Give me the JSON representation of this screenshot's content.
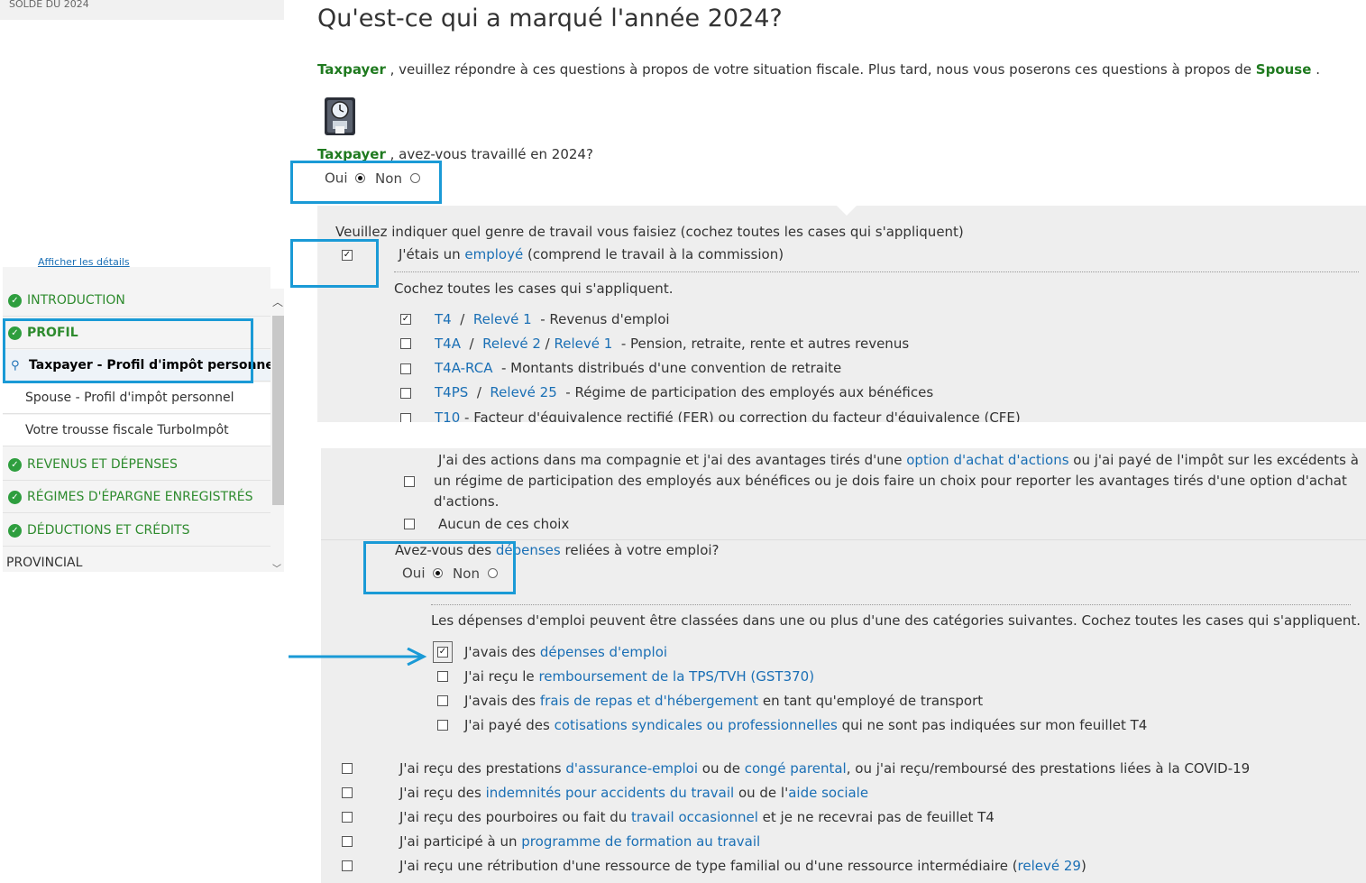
{
  "sidebar": {
    "balance_label": "SOLDE DU 2024",
    "details_link": "Afficher les détails",
    "nav": [
      {
        "label": "INTRODUCTION"
      },
      {
        "label": "PROFIL"
      },
      {
        "label": "Taxpayer - Profil d'impôt personnel"
      },
      {
        "label": "Spouse - Profil d'impôt personnel"
      },
      {
        "label": "Votre trousse fiscale TurboImpôt"
      },
      {
        "label": "REVENUS ET DÉPENSES"
      },
      {
        "label": "RÉGIMES D'ÉPARGNE ENREGISTRÉS"
      },
      {
        "label": "DÉDUCTIONS ET CRÉDITS"
      },
      {
        "label": "PROVINCIAL"
      }
    ]
  },
  "main": {
    "title": "Qu'est-ce qui a marqué l'année 2024?",
    "intro": {
      "name1": "Taxpayer",
      "text": " , veuillez répondre à ces questions à propos de votre situation fiscale. Plus tard, nous vous poserons ces questions à propos de ",
      "name2": "Spouse",
      "end": " ."
    },
    "work_question": {
      "name": "Taxpayer",
      "text": " , avez-vous travaillé en 2024?"
    },
    "radio_yes": "Oui",
    "radio_no": "Non",
    "work_type_prompt": "Veuillez indiquer quel genre de travail vous faisiez (cochez toutes les cases qui s'appliquent)",
    "employee": {
      "pre": "J'étais un ",
      "link": "employé",
      "post": " (comprend le travail à la commission)"
    },
    "check_all": "Cochez toutes les cases qui s'appliquent.",
    "slips": [
      {
        "parts": [
          "T4",
          "  /  ",
          "Relevé 1",
          "  - Revenus d'emploi"
        ],
        "checked": true
      },
      {
        "parts": [
          "T4A",
          "  /  ",
          "Relevé 2",
          " / ",
          "Relevé 1",
          "  - Pension, retraite, rente et autres revenus"
        ],
        "checked": false
      },
      {
        "parts": [
          "T4A-RCA",
          "  - Montants distribués d'une convention de retraite"
        ],
        "checked": false
      },
      {
        "parts": [
          "T4PS",
          "  /  ",
          "Relevé 25",
          "  - Régime de participation des employés aux bénéfices"
        ],
        "checked": false
      },
      {
        "parts": [
          "T10",
          " - Facteur d'équivalence rectifié (FER) ou correction du facteur d'équivalence (CFE)"
        ],
        "checked": false
      }
    ],
    "stock": {
      "line1_pre": "J'ai des actions dans ma compagnie et j'ai des avantages tirés d'une ",
      "line1_link": "option d'achat d'actions",
      "line1_post": " ou j'ai payé de l'impôt sur les excédents à",
      "line2": "un régime de participation des employés aux bénéfices ou je dois faire un choix pour reporter les avantages tirés d'une option d'achat",
      "line3": "d'actions."
    },
    "none_choice": "Aucun de ces choix",
    "expenses_q": {
      "pre": "Avez-vous des ",
      "link": "dépenses",
      "post": " reliées à votre emploi?"
    },
    "expense_categories_note": "Les dépenses d'emploi peuvent être classées dans une ou plus d'une des catégories suivantes. Cochez toutes les cases qui s'appliquent.",
    "expense_items": [
      {
        "pre": "J'avais des ",
        "link": "dépenses d'emploi",
        "post": "",
        "checked": true
      },
      {
        "pre": "J'ai reçu le ",
        "link": "remboursement de la TPS/TVH (GST370)",
        "post": "",
        "checked": false
      },
      {
        "pre": "J'avais des ",
        "link": "frais de repas et d'hébergement",
        "post": " en tant qu'employé de transport",
        "checked": false
      },
      {
        "pre": "J'ai payé des ",
        "link": "cotisations syndicales ou professionnelles",
        "post": " qui ne sont pas indiquées sur mon feuillet T4",
        "checked": false
      }
    ],
    "other_items": [
      {
        "parts": [
          "J'ai reçu des prestations ",
          "d'assurance-emploi",
          " ou de ",
          "congé parental",
          ", ou j'ai reçu/remboursé des prestations liées à la COVID-19"
        ]
      },
      {
        "parts": [
          "J'ai reçu des ",
          "indemnités pour accidents du travail",
          " ou de l'",
          "aide sociale",
          ""
        ]
      },
      {
        "parts": [
          "J'ai reçu des pourboires ou fait du ",
          "travail occasionnel",
          " et je ne recevrai pas de feuillet T4"
        ]
      },
      {
        "parts": [
          "J'ai participé à un ",
          "programme de formation au travail",
          ""
        ]
      },
      {
        "parts": [
          "J'ai reçu une rétribution d'une ressource de type familial ou d'une ressource intermédiaire (",
          "relevé 29",
          ")"
        ]
      }
    ]
  },
  "colors": {
    "accent": "#1a9ad6",
    "link": "#1a6fb5",
    "name_green": "#1f7a1f",
    "nav_green": "#2e8b2e"
  }
}
